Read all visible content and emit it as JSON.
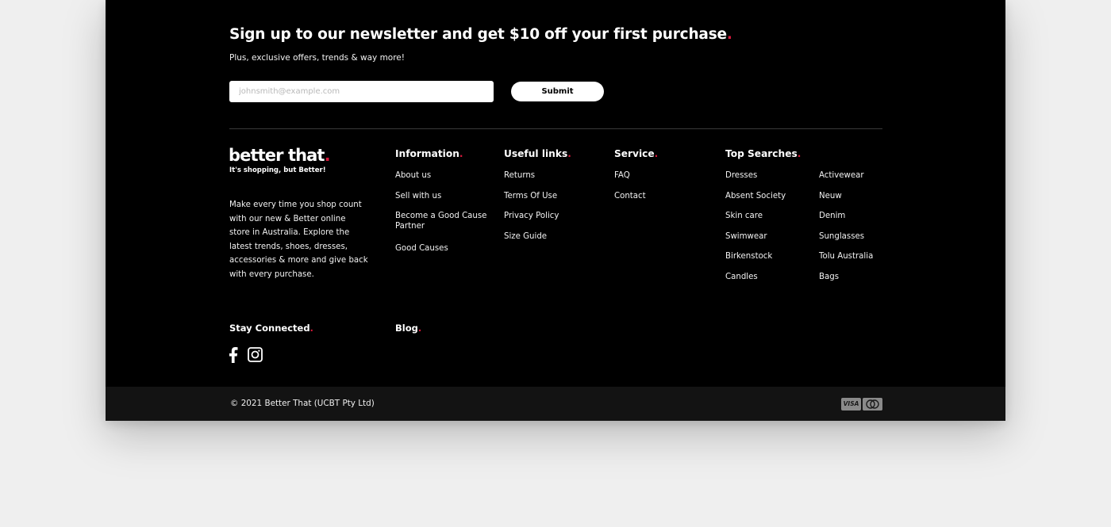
{
  "newsletter": {
    "title": "Sign up to our newsletter and get $10 off your first purchase",
    "title_dot": ".",
    "subtitle": "Plus, exclusive offers, trends & way more!",
    "email_placeholder": "johnsmith@example.com",
    "submit_label": "Submit"
  },
  "brand": {
    "logo_text": "better that",
    "logo_dot": ".",
    "tagline": "It's shopping, but Better!",
    "description": "Make every time you shop count with our new & Better online store in Australia. Explore the latest trends, shoes, dresses, accessories & more and give back with every purchase."
  },
  "columns": {
    "information": {
      "heading": "Information",
      "dot": ".",
      "items": [
        "About us",
        "Sell with us",
        "Become a Good Cause Partner",
        "Good Causes"
      ]
    },
    "useful_links": {
      "heading": "Useful links",
      "dot": ".",
      "items": [
        "Returns",
        "Terms Of Use",
        "Privacy Policy",
        "Size Guide"
      ]
    },
    "service": {
      "heading": "Service",
      "dot": ".",
      "items": [
        "FAQ",
        "Contact"
      ]
    },
    "top_searches": {
      "heading": "Top Searches",
      "dot": ".",
      "items_left": [
        "Dresses",
        "Absent Society",
        "Skin care",
        "Swimwear",
        "Birkenstock",
        "Candles"
      ],
      "items_right": [
        "Activewear",
        "Neuw",
        "Denim",
        "Sunglasses",
        "Tolu Australia",
        "Bags"
      ]
    }
  },
  "stay_connected": {
    "heading": "Stay Connected",
    "dot": ".",
    "icons": [
      "facebook-icon",
      "instagram-icon"
    ]
  },
  "blog": {
    "heading": "Blog",
    "dot": "."
  },
  "bottom_bar": {
    "copyright": "© 2021 Better That (UCBT Pty Ltd)",
    "visa_label": "VISA",
    "payment_icons": [
      "visa-icon",
      "mastercard-icon"
    ]
  },
  "colors": {
    "background": "#000000",
    "accent_dot": "#d6173a",
    "bottom_bar": "#131313",
    "page": "#efefef"
  }
}
